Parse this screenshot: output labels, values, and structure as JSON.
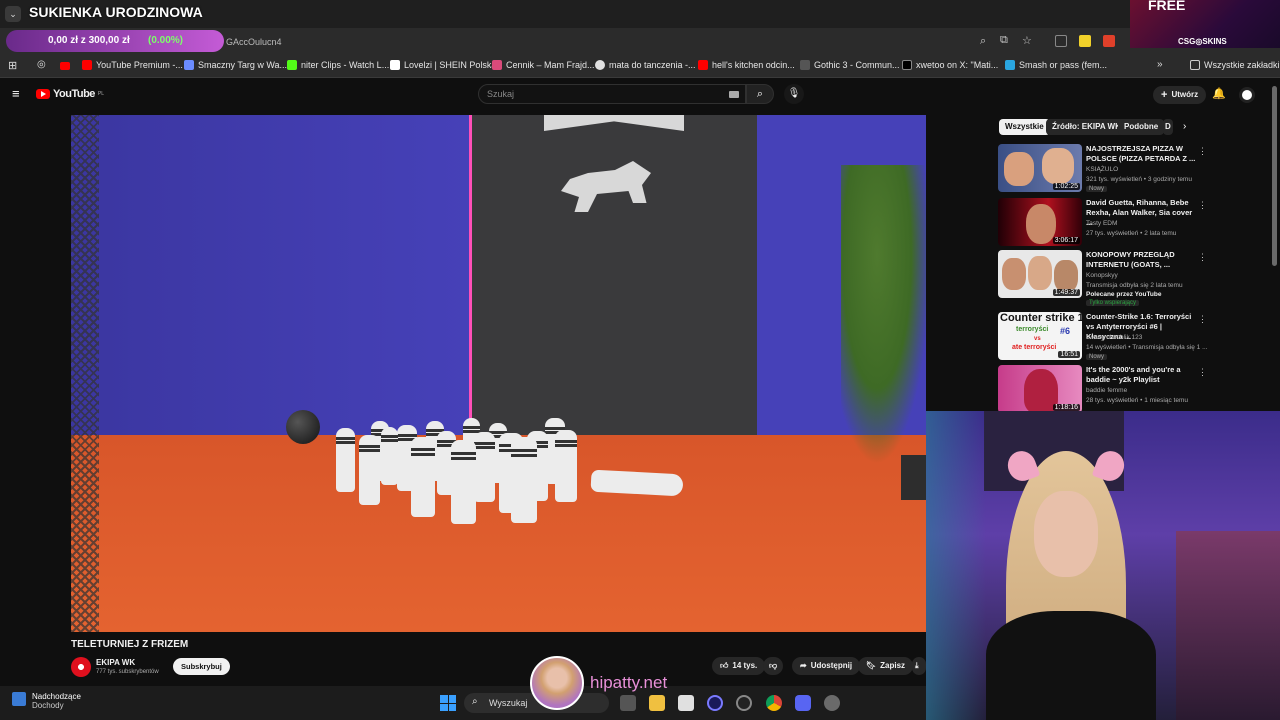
{
  "overlay": {
    "title": "SUKIENKA URODZINOWA",
    "goal_text": "0,00 zł z 300,00 zł",
    "goal_percent": "(0.00%)",
    "goal_fraction": 0.0
  },
  "browser": {
    "url_fragment": "GAccOulucn4",
    "all_bookmarks": "Wszystkie zakładki",
    "bookmarks": [
      {
        "label": "YouTube Premium -...",
        "color": "#ff0000"
      },
      {
        "label": "Smaczny Targ w Wa...",
        "color": "#6b8cff"
      },
      {
        "label": "niter Clips - Watch L...",
        "color": "#53fc18"
      },
      {
        "label": "Lovelzi | SHEIN Polska",
        "color": "#ffffff"
      },
      {
        "label": "Cennik – Mam Frajd...",
        "color": "#d94a7a"
      },
      {
        "label": "mata do tanczenia -...",
        "color": "#e0e0e0"
      },
      {
        "label": "hell's kitchen odcin...",
        "color": "#ff0000"
      },
      {
        "label": "Gothic 3 - Commun...",
        "color": "#555555"
      },
      {
        "label": "xwetoo on X: \"Mati...",
        "color": "#000000"
      },
      {
        "label": "Smash or pass (fem...",
        "color": "#2aa6e0"
      }
    ]
  },
  "youtube": {
    "logo": "YouTube",
    "country": "PL",
    "search_placeholder": "Szukaj",
    "create_label": "Utwórz",
    "video_title": "TELETURNIEJ Z FRIZEM",
    "channel_name": "EKIPA WK",
    "subscribers": "777 tys. subskrybentów",
    "subscribe_label": "Subskrybuj",
    "likes": "14 tys.",
    "share_label": "Udostępnij",
    "save_label": "Zapisz",
    "chips": [
      "Wszystkie",
      "Źródło: EKIPA WK",
      "Podobne"
    ],
    "recommendations": [
      {
        "title": "NAJOSTRZEJSZA PIZZA W POLSCE (PIZZA PETARDA Z ...",
        "channel": "KSIĄŻULO",
        "meta": "321 tys. wyświetleń • 3 godziny temu",
        "badge": "Nowy",
        "duration": "1:02:25"
      },
      {
        "title": "David Guetta, Rihanna, Bebe Rexha, Alan Walker, Sia cover ...",
        "channel": "Tasty EDM",
        "meta": "27 tys. wyświetleń • 2 lata temu",
        "badge": "",
        "duration": "3:06:17"
      },
      {
        "title": "KONOPOWY PRZEGLĄD INTERNETU (GOATS, ...",
        "channel": "Konopskyy",
        "meta": "Transmisja odbyła się 2 lata temu",
        "badge": "Polecane przez YouTube",
        "extra": "Tylko wspierający",
        "duration": "1:49:37"
      },
      {
        "title": "Counter-Strike 1.6: Terroryści vs Antyterroryści #6 | Klasyczna ...",
        "channel": "cwany chochlik 123",
        "meta": "14 wyświetleń • Transmisja odbyła się 1 ...",
        "badge": "Nowy",
        "duration": "16:51"
      },
      {
        "title": "It's the 2000's and you're a baddie ~ y2k Playlist",
        "channel": "baddie femme",
        "meta": "28 tys. wyświetleń • 1 miesiąc temu",
        "badge": "",
        "duration": "1:18:16"
      }
    ],
    "thumb_text": {
      "cs_title": "Counter strike 1.6",
      "cs_t": "terroryści",
      "cs_vs": "vs",
      "cs_ct": "ate terroryści",
      "cs_num": "#6"
    }
  },
  "taskbar": {
    "upcoming": "Nadchodzące",
    "upcoming_sub": "Dochody",
    "search": "Wyszukaj",
    "watermark": "hipatty.net"
  },
  "ad": {
    "free": "FREE",
    "brand": "CSG◎SKINS"
  }
}
